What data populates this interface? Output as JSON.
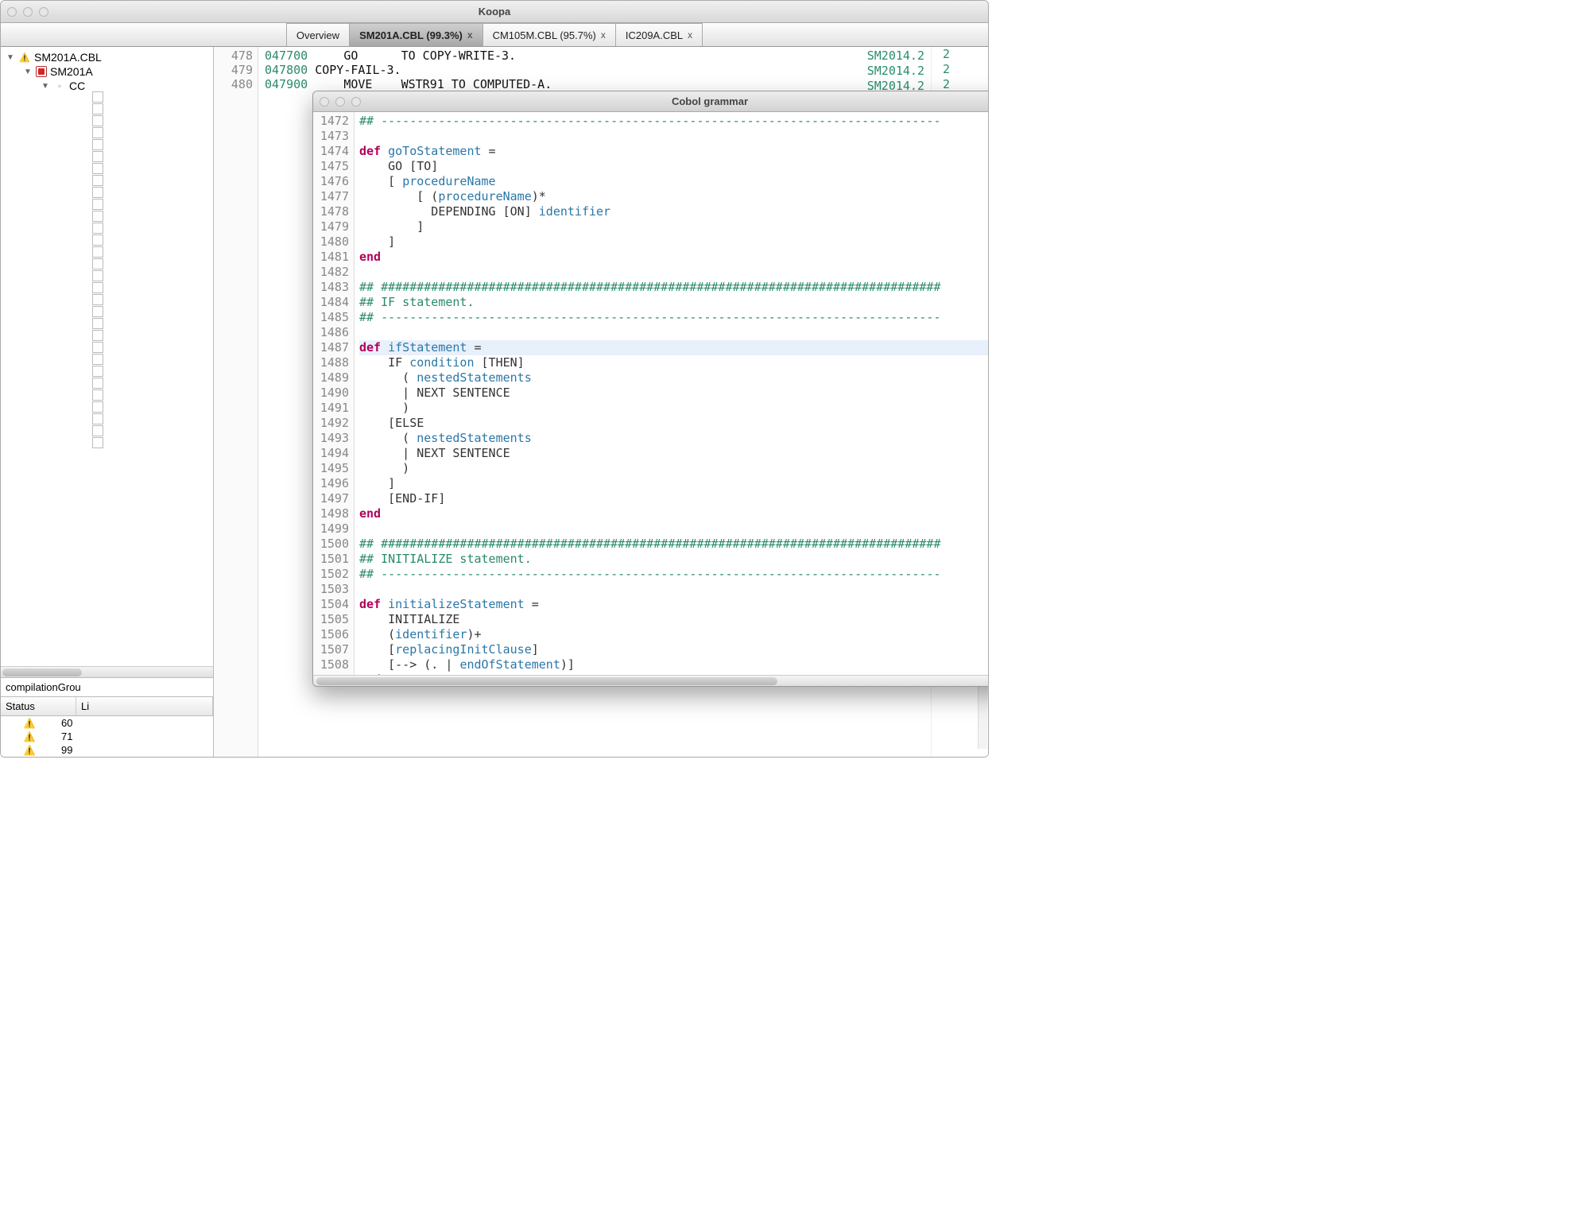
{
  "window": {
    "title": "Koopa"
  },
  "tabs": [
    {
      "label": "Overview",
      "active": false,
      "closeable": false
    },
    {
      "label": "SM201A.CBL (99.3%)",
      "active": true,
      "closeable": true
    },
    {
      "label": "CM105M.CBL (95.7%)",
      "active": false,
      "closeable": true
    },
    {
      "label": "IC209A.CBL",
      "active": false,
      "closeable": true
    }
  ],
  "tree": {
    "items": [
      {
        "indent": 0,
        "arrow": "▼",
        "icon": "warn",
        "label": "SM201A.CBL"
      },
      {
        "indent": 1,
        "arrow": "▼",
        "icon": "red",
        "label": "SM201A"
      },
      {
        "indent": 2,
        "arrow": "▼",
        "icon": "plain",
        "label": "CC"
      }
    ]
  },
  "sidebarFooter": {
    "label": "compilationGrou"
  },
  "statusTable": {
    "headers": [
      "Status",
      "Li"
    ],
    "rows": [
      {
        "icon": "warn",
        "line": "60"
      },
      {
        "icon": "warn",
        "line": "71"
      },
      {
        "icon": "warn",
        "line": "99"
      }
    ]
  },
  "backEditor": {
    "lines": [
      {
        "n": "478",
        "seq": "047700",
        "rest": "     GO      TO COPY-WRITE-3.",
        "ann": "SM2014.2"
      },
      {
        "n": "479",
        "seq": "047800",
        "rest": " COPY-FAIL-3.",
        "ann": "SM2014.2"
      },
      {
        "n": "480",
        "seq": "047900",
        "rest": "     MOVE    WSTR91 TO COMPUTED-A.",
        "ann": "SM2014.2"
      }
    ],
    "rightCol": {
      "count": 41,
      "value": "2",
      "highlights": [
        22,
        26
      ]
    }
  },
  "grammarWindow": {
    "title": "Cobol grammar",
    "firstLine": 1472,
    "highlightLine": 1487,
    "lines": [
      {
        "t": "cmt",
        "s": "## ------------------------------------------------------------------------------"
      },
      {
        "t": "",
        "s": ""
      },
      {
        "t": "def",
        "kw": "def",
        "id": "goToStatement",
        "tail": " ="
      },
      {
        "t": "code",
        "s": "    GO [TO]"
      },
      {
        "t": "mix",
        "pre": "    [ ",
        "id": "procedureName",
        "post": ""
      },
      {
        "t": "mix",
        "pre": "        [ (",
        "id": "procedureName",
        "post": ")*"
      },
      {
        "t": "mix",
        "pre": "          DEPENDING [ON] ",
        "id": "identifier",
        "post": ""
      },
      {
        "t": "code",
        "s": "        ]"
      },
      {
        "t": "code",
        "s": "    ]"
      },
      {
        "t": "end",
        "s": "end"
      },
      {
        "t": "",
        "s": ""
      },
      {
        "t": "cmt",
        "s": "## ##############################################################################"
      },
      {
        "t": "cmt",
        "s": "## IF statement."
      },
      {
        "t": "cmt",
        "s": "## ------------------------------------------------------------------------------"
      },
      {
        "t": "",
        "s": ""
      },
      {
        "t": "def",
        "kw": "def",
        "id": "ifStatement",
        "tail": " ="
      },
      {
        "t": "mix",
        "pre": "    IF ",
        "id": "condition",
        "post": " [THEN]"
      },
      {
        "t": "mix",
        "pre": "      ( ",
        "id": "nestedStatements",
        "post": ""
      },
      {
        "t": "code",
        "s": "      | NEXT SENTENCE"
      },
      {
        "t": "code",
        "s": "      )"
      },
      {
        "t": "code",
        "s": "    [ELSE"
      },
      {
        "t": "mix",
        "pre": "      ( ",
        "id": "nestedStatements",
        "post": ""
      },
      {
        "t": "code",
        "s": "      | NEXT SENTENCE"
      },
      {
        "t": "code",
        "s": "      )"
      },
      {
        "t": "code",
        "s": "    ]"
      },
      {
        "t": "code",
        "s": "    [END-IF]"
      },
      {
        "t": "end",
        "s": "end"
      },
      {
        "t": "",
        "s": ""
      },
      {
        "t": "cmt",
        "s": "## ##############################################################################"
      },
      {
        "t": "cmt",
        "s": "## INITIALIZE statement."
      },
      {
        "t": "cmt",
        "s": "## ------------------------------------------------------------------------------"
      },
      {
        "t": "",
        "s": ""
      },
      {
        "t": "def",
        "kw": "def",
        "id": "initializeStatement",
        "tail": " ="
      },
      {
        "t": "code",
        "s": "    INITIALIZE"
      },
      {
        "t": "mix",
        "pre": "    (",
        "id": "identifier",
        "post": ")+"
      },
      {
        "t": "mix",
        "pre": "    [",
        "id": "replacingInitClause",
        "post": "]"
      },
      {
        "t": "mix",
        "pre": "    [--> (. | ",
        "id": "endOfStatement",
        "post": ")]"
      },
      {
        "t": "end",
        "s": "end"
      }
    ]
  }
}
